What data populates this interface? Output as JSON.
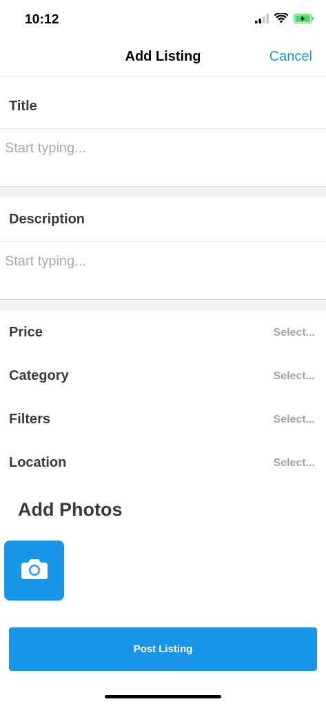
{
  "status_bar": {
    "time": "10:12",
    "icons": [
      "cellular-signal-icon",
      "wifi-icon",
      "battery-charging-icon"
    ],
    "battery_color": "#4cd964"
  },
  "nav": {
    "title": "Add Listing",
    "cancel_label": "Cancel"
  },
  "form": {
    "title_label": "Title",
    "title_placeholder": "Start typing...",
    "title_value": "",
    "description_label": "Description",
    "description_placeholder": "Start typing...",
    "description_value": "",
    "rows": [
      {
        "label": "Price",
        "value": "Select..."
      },
      {
        "label": "Category",
        "value": "Select..."
      },
      {
        "label": "Filters",
        "value": "Select..."
      },
      {
        "label": "Location",
        "value": "Select..."
      }
    ]
  },
  "photos": {
    "heading": "Add Photos",
    "camera_icon": "camera-icon"
  },
  "actions": {
    "post_label": "Post Listing"
  },
  "colors": {
    "accent": "#1a96e8",
    "link": "#1a96dd"
  }
}
